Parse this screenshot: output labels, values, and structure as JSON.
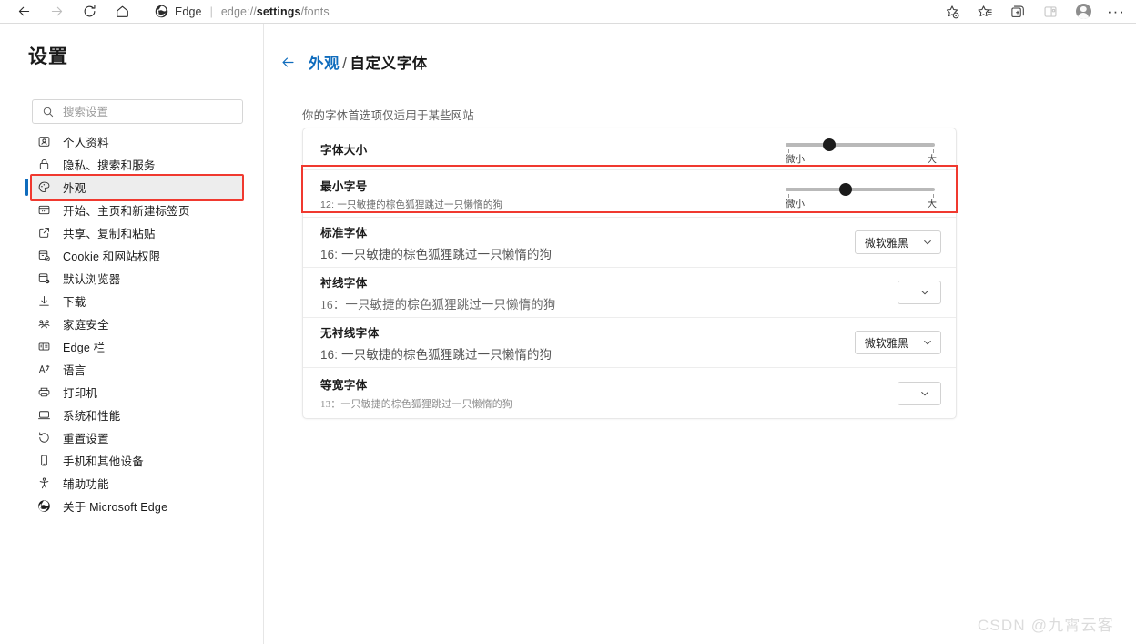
{
  "browser": {
    "nav": {
      "back": "后退",
      "forward": "前进",
      "refresh": "刷新",
      "home": "主页"
    },
    "omnibox": {
      "app_label": "Edge",
      "separator": "|",
      "url_prefix": "edge://",
      "url_bold": "settings",
      "url_suffix": "/fonts"
    },
    "toolbar_right": {
      "favorite": "添加到收藏夹",
      "favorites": "收藏夹",
      "collections": "集锦",
      "split_screen": "拆分屏幕",
      "profile": "个人资料",
      "more": "···"
    }
  },
  "sidebar": {
    "title": "设置",
    "search": {
      "placeholder": "搜索设置",
      "value": "",
      "icon": "search-icon"
    },
    "items": [
      {
        "label": "个人资料",
        "icon": "profile-icon",
        "selected": false
      },
      {
        "label": "隐私、搜索和服务",
        "icon": "lock-icon",
        "selected": false
      },
      {
        "label": "外观",
        "icon": "palette-icon",
        "selected": true
      },
      {
        "label": "开始、主页和新建标签页",
        "icon": "window-icon",
        "selected": false
      },
      {
        "label": "共享、复制和粘贴",
        "icon": "share-icon",
        "selected": false
      },
      {
        "label": "Cookie 和网站权限",
        "icon": "cookie-permissions-icon",
        "selected": false
      },
      {
        "label": "默认浏览器",
        "icon": "default-browser-icon",
        "selected": false
      },
      {
        "label": "下载",
        "icon": "download-icon",
        "selected": false
      },
      {
        "label": "家庭安全",
        "icon": "family-icon",
        "selected": false
      },
      {
        "label": "Edge 栏",
        "icon": "edge-bar-icon",
        "selected": false
      },
      {
        "label": "语言",
        "icon": "language-icon",
        "selected": false
      },
      {
        "label": "打印机",
        "icon": "printer-icon",
        "selected": false
      },
      {
        "label": "系统和性能",
        "icon": "system-icon",
        "selected": false
      },
      {
        "label": "重置设置",
        "icon": "reset-icon",
        "selected": false
      },
      {
        "label": "手机和其他设备",
        "icon": "phone-icon",
        "selected": false
      },
      {
        "label": "辅助功能",
        "icon": "accessibility-icon",
        "selected": false
      },
      {
        "label": "关于 Microsoft Edge",
        "icon": "edge-logo-icon",
        "selected": false
      }
    ]
  },
  "main": {
    "breadcrumb": {
      "back_icon": "back-arrow-icon",
      "parent": "外观",
      "slash": "/",
      "current": "自定义字体"
    },
    "subtitle": "你的字体首选项仅适用于某些网站",
    "settings": [
      {
        "type": "slider",
        "title": "字体大小",
        "sample": "",
        "slider": {
          "min_label": "微小",
          "max_label": "大",
          "percent": 29
        }
      },
      {
        "type": "slider",
        "title": "最小字号",
        "sample": "12: 一只敏捷的棕色狐狸跳过一只懒惰的狗",
        "slider": {
          "min_label": "微小",
          "max_label": "大",
          "percent": 40
        },
        "highlighted": true
      },
      {
        "type": "select",
        "title": "标准字体",
        "sample": "16: 一只敏捷的棕色狐狸跳过一只懒惰的狗",
        "select": {
          "value": "微软雅黑",
          "chevron": "chevron-down-icon"
        }
      },
      {
        "type": "select",
        "title": "衬线字体",
        "sample": "16：一只敏捷的棕色狐狸跳过一只懒惰的狗",
        "select": {
          "value": "",
          "chevron": "chevron-down-icon"
        }
      },
      {
        "type": "select",
        "title": "无衬线字体",
        "sample": "16: 一只敏捷的棕色狐狸跳过一只懒惰的狗",
        "select": {
          "value": "微软雅黑",
          "chevron": "chevron-down-icon"
        }
      },
      {
        "type": "select",
        "title": "等宽字体",
        "sample": "13：一只敏捷的棕色狐狸跳过一只懒惰的狗",
        "select": {
          "value": "",
          "chevron": "chevron-down-icon"
        }
      }
    ]
  },
  "watermark": "CSDN @九霄云客",
  "colors": {
    "accent": "#0f6cbd",
    "highlight_box": "#f0392f",
    "selected_row_bg": "#ededed",
    "slider_thumb": "#1b1b1b",
    "track": "#b9b9b9"
  }
}
